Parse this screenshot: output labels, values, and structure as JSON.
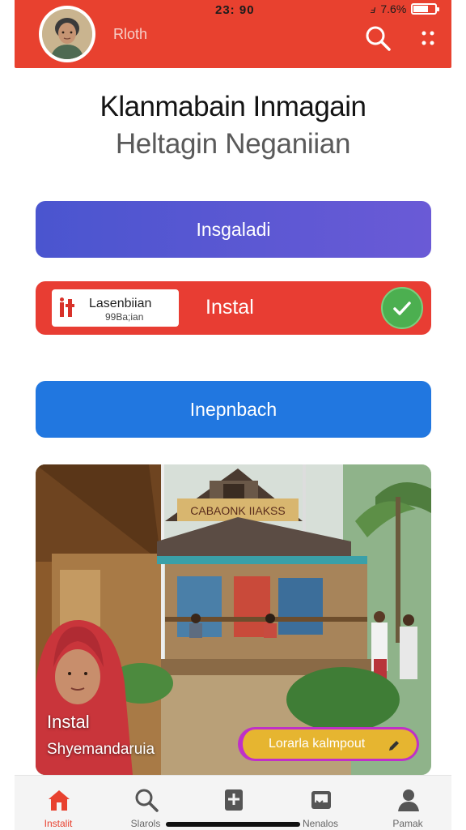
{
  "status": {
    "time": "23: 90",
    "battery": "7.6%"
  },
  "header": {
    "title": "Rloth",
    "avatar_icon": "user-avatar",
    "search_icon": "search-icon",
    "menu_icon": "grid-dots-icon",
    "color": "#e8412f"
  },
  "hero": {
    "title": "Klanmabain Inmagain",
    "subtitle": "Heltagin Neganiian"
  },
  "buttons": {
    "primary_label": "Insgaladi",
    "install": {
      "box_line1": "Lasenbiian",
      "box_line2": "99Ba;ian",
      "label": "Instal",
      "check_icon": "checkmark-icon"
    },
    "secondary_label": "Inepnbach"
  },
  "photo": {
    "sign_text": "CABAONK IIAKSS",
    "caption_line1": "Instal",
    "caption_line2": "Shyemandaruia",
    "chip_label": "Lorarla kalmpout",
    "chip_icon": "pencil-icon"
  },
  "nav": {
    "items": [
      {
        "label": "Instalit",
        "icon": "home-icon",
        "active": true
      },
      {
        "label": "Slarols",
        "icon": "search-icon",
        "active": false
      },
      {
        "label": "",
        "icon": "bookmark-plus-icon",
        "active": false
      },
      {
        "label": "Nenalos",
        "icon": "inbox-icon",
        "active": false
      },
      {
        "label": "Pamak",
        "icon": "profile-icon",
        "active": false
      }
    ]
  },
  "colors": {
    "accent": "#e8412f",
    "purple": "#4a55cf",
    "blue": "#2177e0",
    "green": "#4caf50",
    "chip": "#e6b530"
  }
}
